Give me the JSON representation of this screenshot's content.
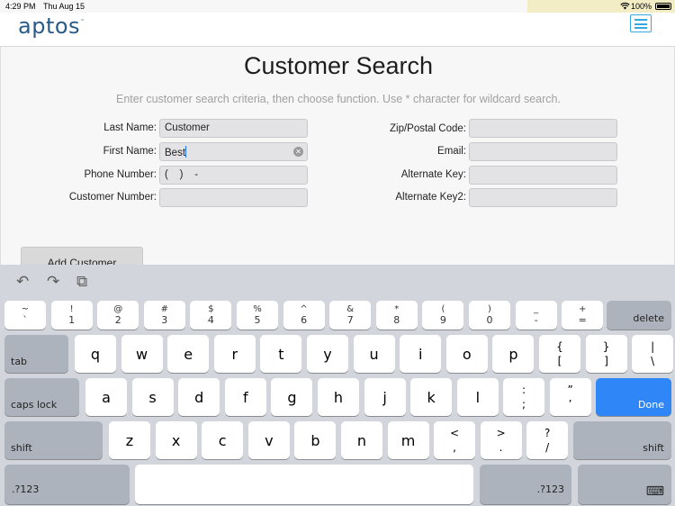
{
  "status": {
    "time": "4:29 PM",
    "date": "Thu Aug 15",
    "battery": "100%"
  },
  "header": {
    "logo": "aptos",
    "logo_mark": "™"
  },
  "main": {
    "title": "Customer Search",
    "subtitle": "Enter customer search criteria, then choose function. Use * character for wildcard search.",
    "fields": {
      "last_name_label": "Last Name:",
      "last_name_value": "Customer",
      "first_name_label": "First Name:",
      "first_name_value": "Best",
      "phone_label": "Phone Number:",
      "phone_value": "(    )    -",
      "customer_number_label": "Customer Number:",
      "customer_number_value": "",
      "zip_label": "Zip/Postal Code:",
      "zip_value": "",
      "email_label": "Email:",
      "email_value": "",
      "alt_key_label": "Alternate Key:",
      "alt_key_value": "",
      "alt_key2_label": "Alternate Key2:",
      "alt_key2_value": ""
    },
    "add_customer": "Add Customer"
  },
  "keyboard": {
    "toolbar": {
      "undo": "↶",
      "redo": "↷",
      "paste": "⧉"
    },
    "row1": [
      {
        "up": "~",
        "dn": "`"
      },
      {
        "up": "!",
        "dn": "1"
      },
      {
        "up": "@",
        "dn": "2"
      },
      {
        "up": "#",
        "dn": "3"
      },
      {
        "up": "$",
        "dn": "4"
      },
      {
        "up": "%",
        "dn": "5"
      },
      {
        "up": "^",
        "dn": "6"
      },
      {
        "up": "&",
        "dn": "7"
      },
      {
        "up": "*",
        "dn": "8"
      },
      {
        "up": "(",
        "dn": "9"
      },
      {
        "up": ")",
        "dn": "0"
      },
      {
        "up": "_",
        "dn": "-"
      },
      {
        "up": "+",
        "dn": "="
      }
    ],
    "delete": "delete",
    "tab": "tab",
    "row2": [
      "q",
      "w",
      "e",
      "r",
      "t",
      "y",
      "u",
      "i",
      "o",
      "p"
    ],
    "row2_pairs": [
      {
        "up": "{",
        "dn": "["
      },
      {
        "up": "}",
        "dn": "]"
      },
      {
        "up": "|",
        "dn": "\\"
      }
    ],
    "caps_lock": "caps lock",
    "row3": [
      "a",
      "s",
      "d",
      "f",
      "g",
      "h",
      "j",
      "k",
      "l"
    ],
    "row3_pairs": [
      {
        "up": ":",
        "dn": ";"
      },
      {
        "up": "”",
        "dn": "’"
      }
    ],
    "done": "Done",
    "shift": "shift",
    "row4": [
      "z",
      "x",
      "c",
      "v",
      "b",
      "n",
      "m"
    ],
    "row4_pairs": [
      {
        "up": "<",
        "dn": ","
      },
      {
        "up": ">",
        "dn": "."
      },
      {
        "up": "?",
        "dn": "/"
      }
    ],
    "numbers_label": ".?123",
    "hide_keyboard": "⌨"
  }
}
